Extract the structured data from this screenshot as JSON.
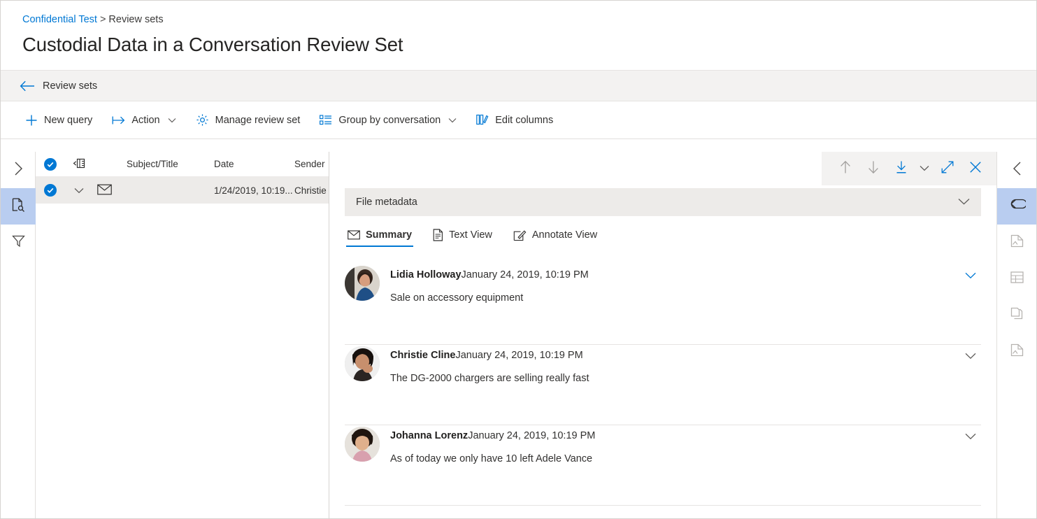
{
  "header": {
    "breadcrumb": {
      "root": "Confidential Test",
      "separator": ">",
      "current": "Review sets"
    },
    "title": "Custodial Data in a Conversation Review Set"
  },
  "back_bar": {
    "label": "Review sets",
    "icon": "arrow-left-icon"
  },
  "command_bar": {
    "items": [
      {
        "label": "New query",
        "icon": "plus-icon",
        "has_chevron": false
      },
      {
        "label": "Action",
        "icon": "action-arrow-icon",
        "has_chevron": true
      },
      {
        "label": "Manage review set",
        "icon": "gear-icon",
        "has_chevron": false
      },
      {
        "label": "Group by conversation",
        "icon": "group-list-icon",
        "has_chevron": true
      },
      {
        "label": "Edit columns",
        "icon": "edit-columns-icon",
        "has_chevron": false
      }
    ]
  },
  "left_rail": {
    "items": [
      {
        "icon": "chevron-right-icon",
        "name": "expand-nav",
        "active": false,
        "muted": false
      },
      {
        "icon": "file-search-icon",
        "name": "search-pane",
        "active": true,
        "muted": false
      },
      {
        "icon": "filter-funnel-icon",
        "name": "filter-pane",
        "active": false,
        "muted": false
      }
    ]
  },
  "right_rail": {
    "items": [
      {
        "icon": "chevron-left-icon",
        "name": "collapse-panel",
        "active": false,
        "muted": false
      },
      {
        "icon": "tag-icon",
        "name": "tags-panel",
        "active": true,
        "muted": false
      },
      {
        "icon": "file-image-icon",
        "name": "file-panel",
        "active": false,
        "muted": true
      },
      {
        "icon": "table-icon",
        "name": "table-panel",
        "active": false,
        "muted": true
      },
      {
        "icon": "copy-icon",
        "name": "duplicates-panel",
        "active": false,
        "muted": true
      },
      {
        "icon": "file-image-alt-icon",
        "name": "attachments-panel",
        "active": false,
        "muted": true
      }
    ]
  },
  "list": {
    "columns": [
      {
        "key": "check",
        "label": ""
      },
      {
        "key": "expand",
        "label": ""
      },
      {
        "key": "type",
        "label": ""
      },
      {
        "key": "subject",
        "label": "Subject/Title"
      },
      {
        "key": "date",
        "label": "Date"
      },
      {
        "key": "sender",
        "label": "Sender"
      }
    ],
    "header_icon": "collapse-groups-icon",
    "rows": [
      {
        "selected": true,
        "type_icon": "mail-icon",
        "subject": "",
        "date": "1/24/2019, 10:19...",
        "sender": "Christie"
      }
    ]
  },
  "detail": {
    "toolbar": [
      {
        "icon": "arrow-up-icon",
        "name": "previous-item-button",
        "disabled": true
      },
      {
        "icon": "arrow-down-icon",
        "name": "next-item-button",
        "disabled": true
      },
      {
        "icon": "download-icon",
        "name": "download-button",
        "disabled": false
      },
      {
        "icon": "chevron-down-icon",
        "name": "download-options-button",
        "disabled": false
      },
      {
        "icon": "expand-diagonal-icon",
        "name": "expand-button",
        "disabled": false
      },
      {
        "icon": "close-icon",
        "name": "close-button",
        "disabled": false
      }
    ],
    "metadata_bar": {
      "label": "File metadata",
      "chevron": "chevron-down-icon"
    },
    "tabs": [
      {
        "label": "Summary",
        "icon": "mail-icon",
        "active": true
      },
      {
        "label": "Text View",
        "icon": "document-icon",
        "active": false
      },
      {
        "label": "Annotate View",
        "icon": "annotate-pen-icon",
        "active": false
      }
    ],
    "messages": [
      {
        "sender": "Lidia Holloway",
        "timestamp": "January 24, 2019, 10:19 PM",
        "preview": "Sale on accessory equipment",
        "avatar": "avatar-lidia-holloway",
        "chevron": "chevron-down-icon"
      },
      {
        "sender": "Christie Cline",
        "timestamp": "January 24, 2019, 10:19 PM",
        "preview": "The DG-2000 chargers are selling really fast",
        "avatar": "avatar-christie-cline",
        "chevron": "chevron-down-icon"
      },
      {
        "sender": "Johanna Lorenz",
        "timestamp": "January 24, 2019, 10:19 PM",
        "preview": "As of today we only have 10 left Adele Vance",
        "avatar": "avatar-johanna-lorenz",
        "chevron": "chevron-down-icon"
      }
    ]
  },
  "colors": {
    "accent": "#0078d4",
    "rail_active": "#b9cdf0",
    "row_selected": "#edebe9",
    "toolbar_bg": "#f3f2f1"
  }
}
